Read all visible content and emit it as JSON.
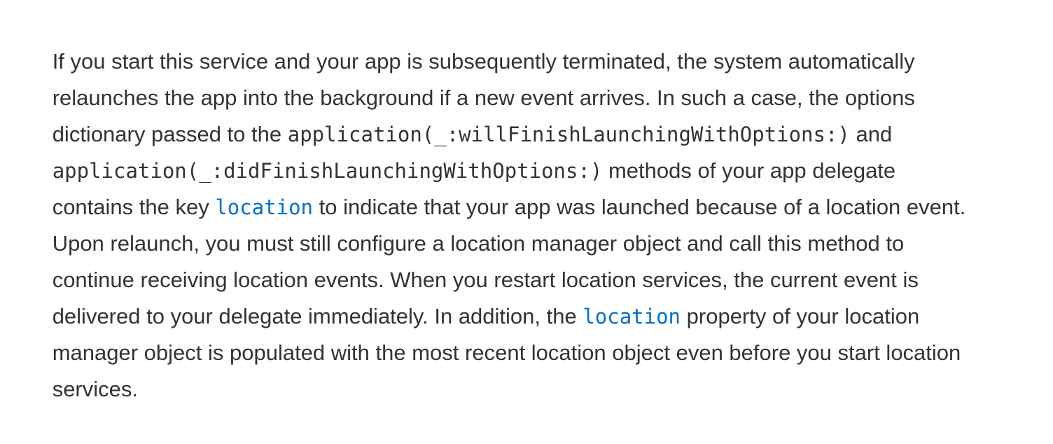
{
  "paragraph": {
    "l1": {
      "t": "If you start this service and your app is subsequently terminated, the system automatically"
    },
    "l2": {
      "t": "relaunches the app into the background if a new event arrives. In such a case, the options"
    },
    "l3": {
      "a": "dictionary passed to the ",
      "code": "application(_:willFinishLaunchingWithOptions:)",
      "b": " and"
    },
    "l4": {
      "code": "application(_:didFinishLaunchingWithOptions:)",
      "b": " methods of your app delegate"
    },
    "l5": {
      "a": "contains the key ",
      "link": "location",
      "b": " to indicate that your app was launched because of a location event."
    },
    "l6": {
      "t": "Upon relaunch, you must still configure a location manager object and call this method to"
    },
    "l7": {
      "t": "continue receiving location events. When you restart location services, the current event is"
    },
    "l8": {
      "a": "delivered to your delegate immediately. In addition, the ",
      "link": "location",
      "b": " property of your location"
    },
    "l9": {
      "t": "manager object is populated with the most recent location object even before you start location"
    },
    "l10": {
      "t": "services."
    }
  },
  "colors": {
    "text": "#333333",
    "link": "#0070c9",
    "background": "#ffffff"
  }
}
